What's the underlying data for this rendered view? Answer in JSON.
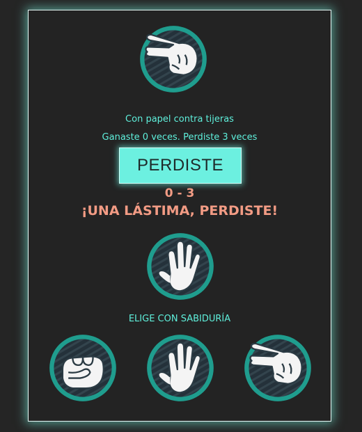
{
  "computer_choice": {
    "icon": "scissors-hand-icon"
  },
  "player_choice": {
    "icon": "paper-hand-icon"
  },
  "round_text": "Con papel contra tijeras",
  "tally_text": "Ganaste 0 veces. Perdiste 3 veces",
  "result_label": "PERDISTE",
  "score_text": "0 - 3",
  "final_message": "¡UNA LÁSTIMA, PERDISTE!",
  "prompt": "ELIGE CON SABIDURÍA",
  "choices": [
    {
      "icon": "rock-hand-icon"
    },
    {
      "icon": "paper-hand-icon"
    },
    {
      "icon": "scissors-hand-icon"
    }
  ],
  "colors": {
    "background": "#252525",
    "accent": "#5ff0dc",
    "button_bg": "#6cf0e0",
    "ring": "#1f9d8e",
    "lose": "#f29b84"
  }
}
